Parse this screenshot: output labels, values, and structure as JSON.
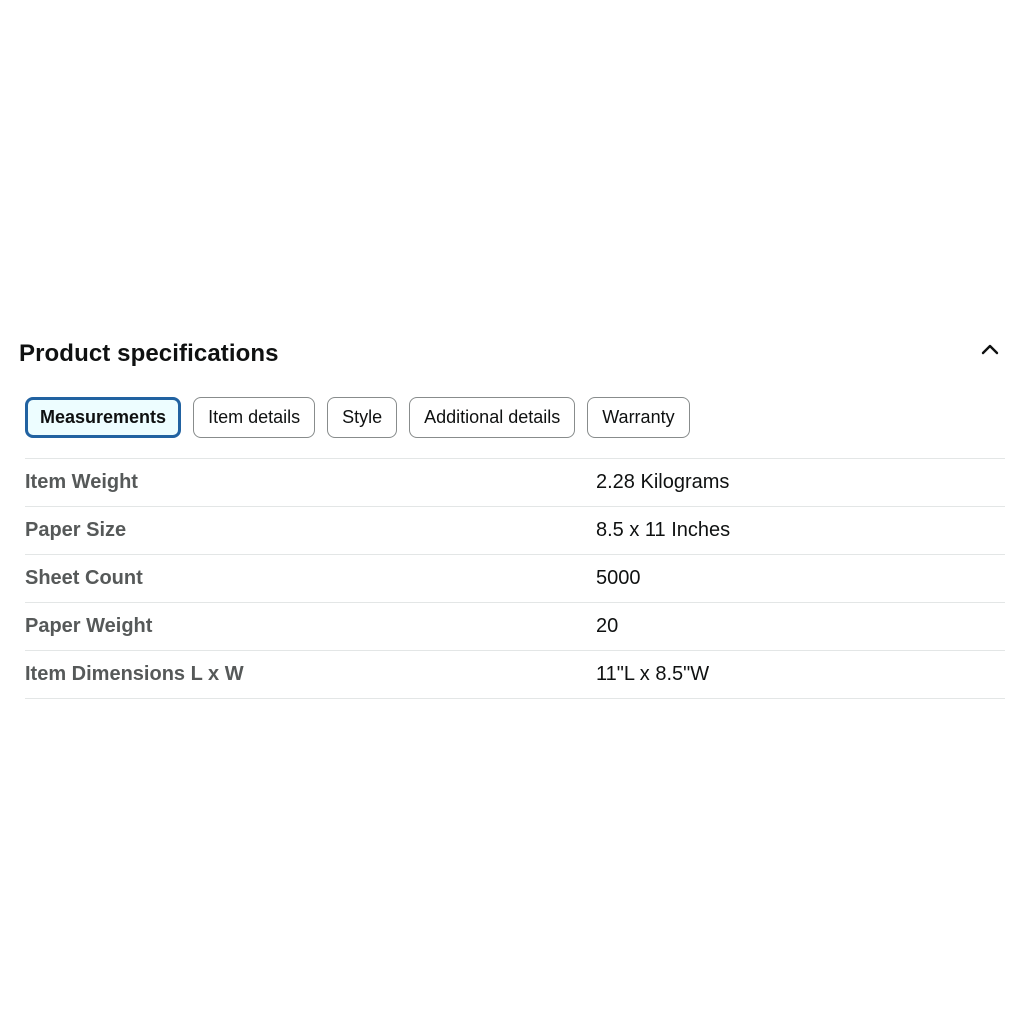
{
  "section": {
    "title": "Product specifications",
    "collapse_icon": "chevron-up-icon"
  },
  "tabs": [
    {
      "label": "Measurements",
      "active": true
    },
    {
      "label": "Item details",
      "active": false
    },
    {
      "label": "Style",
      "active": false
    },
    {
      "label": "Additional details",
      "active": false
    },
    {
      "label": "Warranty",
      "active": false
    }
  ],
  "specs": [
    {
      "label": "Item Weight",
      "value": "2.28 Kilograms"
    },
    {
      "label": "Paper Size",
      "value": "8.5 x 11 Inches"
    },
    {
      "label": "Sheet Count",
      "value": "5000"
    },
    {
      "label": "Paper Weight",
      "value": "20"
    },
    {
      "label": "Item Dimensions L x W",
      "value": "11\"L x 8.5\"W"
    }
  ],
  "colors": {
    "active_tab_border": "#2162a1",
    "active_tab_bg": "#edfdff",
    "label_text": "#565959",
    "value_text": "#0f1111"
  }
}
